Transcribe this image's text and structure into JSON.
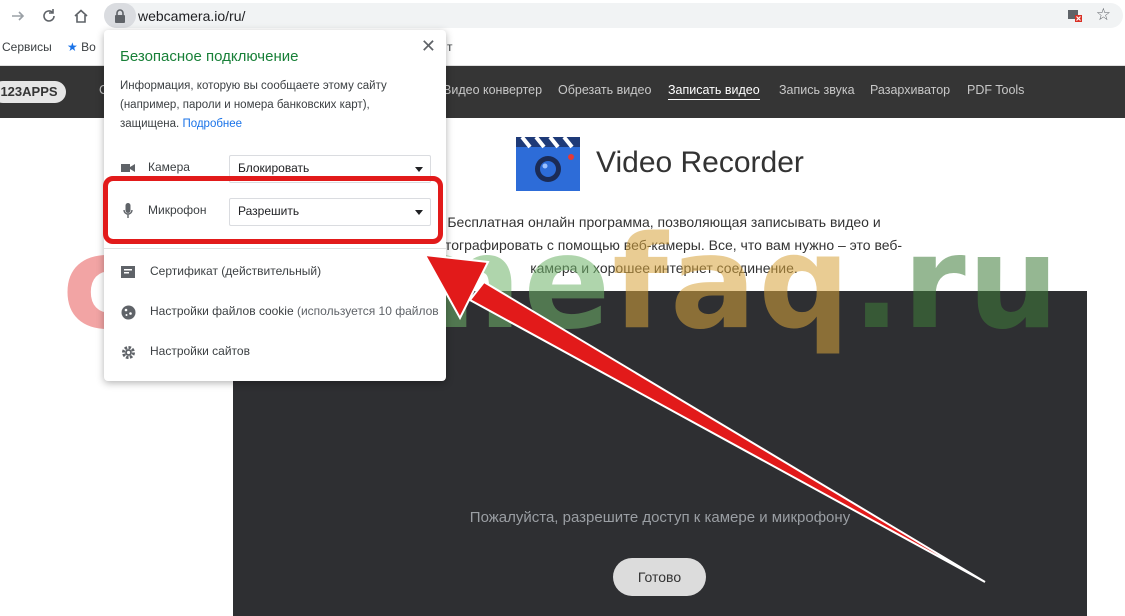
{
  "browser": {
    "url": "webcamera.io/ru/",
    "bookmarks": [
      "Сервисы",
      "Во",
      "т"
    ]
  },
  "site": {
    "logo": "123APPS",
    "nav_partial": "С",
    "nav": [
      "Видео конвертер",
      "Обрезать видео",
      "Записать видео",
      "Запись звука",
      "Разархиватор",
      "PDF Tools"
    ],
    "active_index": 2,
    "title": "Video Recorder",
    "description": "Бесплатная онлайн программа, позволяющая записывать видео и фотографировать с помощью веб-камеры. Все, что вам нужно – это веб-камера и хорошее интернет соединение.",
    "permission_message": "Пожалуйста, разрешите доступ к камере и микрофону",
    "done_button": "Готово"
  },
  "popup": {
    "title": "Безопасное подключение",
    "description": "Информация, которую вы сообщаете этому сайту (например, пароли и номера банковских карт), защищена.",
    "more_link": "Подробнее",
    "camera_label": "Камера",
    "camera_value": "Блокировать",
    "mic_label": "Микрофон",
    "mic_value": "Разрешить",
    "certificate": "Сертификат (действительный)",
    "cookies_label": "Настройки файлов cookie",
    "cookies_note": "(используется 10 файлов",
    "site_settings": "Настройки сайтов"
  },
  "watermark": {
    "part1": "chro",
    "part2": "me",
    "part3": "faq",
    "part4": ".ru"
  },
  "colors": {
    "secure_green": "#188038",
    "link_blue": "#1a73e8",
    "highlight_red": "#e21a1a",
    "nav_bg": "#353535",
    "video_bg": "#2e2f32"
  }
}
